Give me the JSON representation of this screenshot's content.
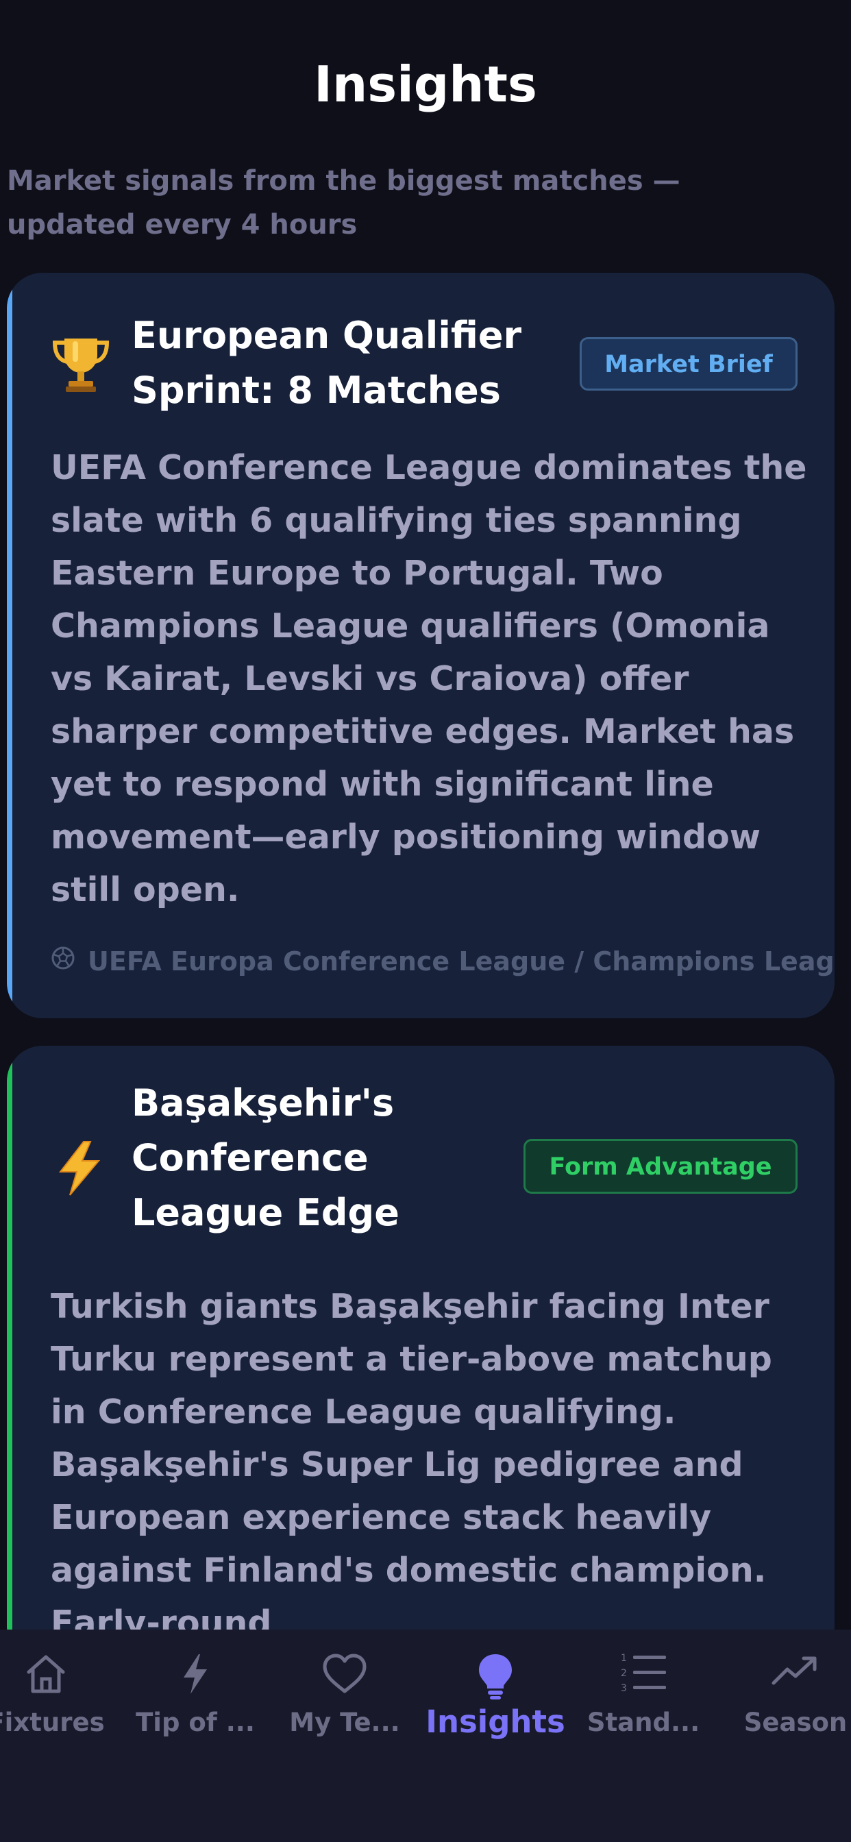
{
  "header": {
    "title": "Insights",
    "subtitle": "Market signals from the biggest matches — updated every 4 hours"
  },
  "cards": [
    {
      "icon": "trophy-icon",
      "title": "European Qualifier Sprint: 8 Matches",
      "badge": "Market Brief",
      "body": "UEFA Conference League dominates the slate with 6 qualifying ties spanning Eastern Europe to Portugal. Two Champions League qualifiers (Omonia vs Kairat, Levski vs Craiova) offer sharper competitive edges. Market has yet to respond with significant line movement—early positioning window still open.",
      "tag": "UEFA Europa Conference League / Champions League",
      "accent": "#5aa7f5",
      "badge_color": "#62aef2",
      "badge_bg": "#1c3459",
      "badge_border": "#3d5f8c"
    },
    {
      "icon": "lightning-icon",
      "title": "Başakşehir's Conference League Edge",
      "badge": "Form Advantage",
      "body": "Turkish giants Başakşehir facing Inter Turku represent a tier-above matchup in Conference League qualifying. Başakşehir's Super Lig pedigree and European experience stack heavily against Finland's domestic champion. Early-round",
      "accent": "#20c05a",
      "badge_color": "#2fcf66",
      "badge_bg": "#0f3a2c",
      "badge_border": "#1e7a48"
    }
  ],
  "tabbar": {
    "tabs": [
      {
        "label": "Fixtures",
        "icon": "home-icon",
        "active": false
      },
      {
        "label": "Tip of ...",
        "icon": "bolt-icon",
        "active": false
      },
      {
        "label": "My Te...",
        "icon": "heart-icon",
        "active": false
      },
      {
        "label": "Insights",
        "icon": "lightbulb-icon",
        "active": true
      },
      {
        "label": "Stand...",
        "icon": "numbered-list-icon",
        "active": false
      },
      {
        "label": "Season",
        "icon": "trend-icon",
        "active": false
      }
    ],
    "active_color": "#7b73f7",
    "inactive_color": "#6e6d88"
  }
}
